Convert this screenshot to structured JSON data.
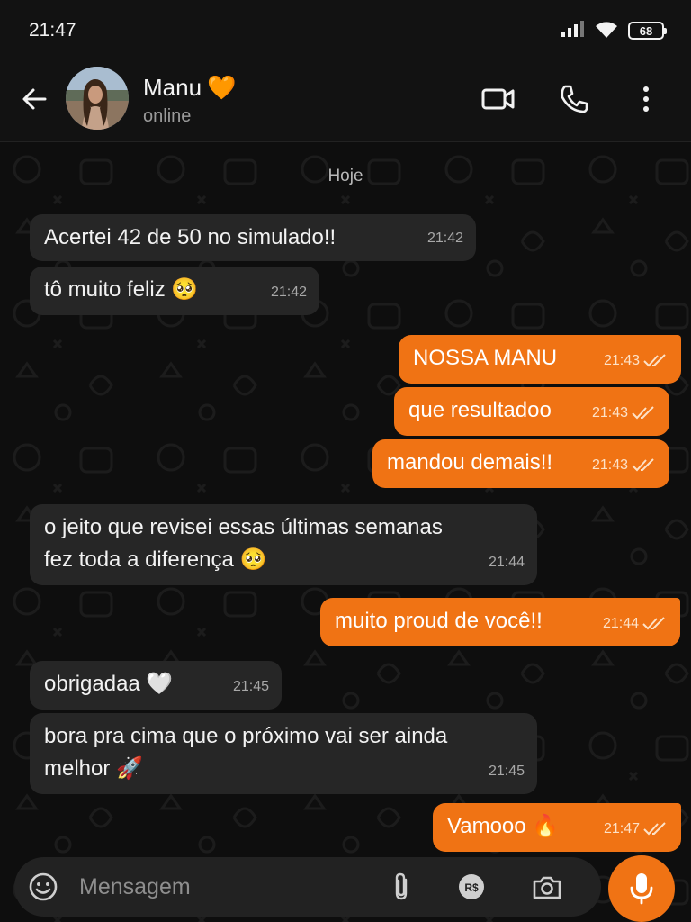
{
  "status_bar": {
    "time": "21:47",
    "battery": "68"
  },
  "header": {
    "contact_name": "Manu",
    "contact_emoji": "🧡",
    "contact_status": "online"
  },
  "chat": {
    "date_label": "Hoje",
    "messages": [
      {
        "dir": "in",
        "text": "Acertei 42 de 50 no simulado!!",
        "time": "21:42"
      },
      {
        "dir": "in",
        "text": "tô muito feliz 🥺",
        "time": "21:42"
      },
      {
        "dir": "out",
        "text": "NOSSA MANU",
        "time": "21:43",
        "read": true
      },
      {
        "dir": "out",
        "text": "que resultadoo",
        "time": "21:43",
        "read": true
      },
      {
        "dir": "out",
        "text": "mandou demais!!",
        "time": "21:43",
        "read": true
      },
      {
        "dir": "in",
        "text": "o jeito que revisei essas últimas semanas\nfez toda a diferença 🥺",
        "time": "21:44"
      },
      {
        "dir": "out",
        "text": "muito proud de você!!",
        "time": "21:44",
        "read": true
      },
      {
        "dir": "in",
        "text": "obrigadaa 🤍",
        "time": "21:45"
      },
      {
        "dir": "in",
        "text": "bora pra cima que o próximo vai ser ainda\nmelhor 🚀",
        "time": "21:45"
      },
      {
        "dir": "out",
        "text": "Vamooo 🔥",
        "time": "21:47",
        "read": true
      }
    ]
  },
  "input": {
    "placeholder": "Mensagem"
  },
  "colors": {
    "accent": "#f07314",
    "incoming_bubble": "#262626",
    "background": "#0e0e0e",
    "read_check": "#fde2c8"
  },
  "icons": [
    "signal-icon",
    "wifi-icon",
    "battery-icon",
    "back-arrow-icon",
    "video-call-icon",
    "phone-icon",
    "more-vert-icon",
    "emoji-icon",
    "attach-icon",
    "payment-icon",
    "camera-icon",
    "mic-icon",
    "double-check-icon"
  ]
}
